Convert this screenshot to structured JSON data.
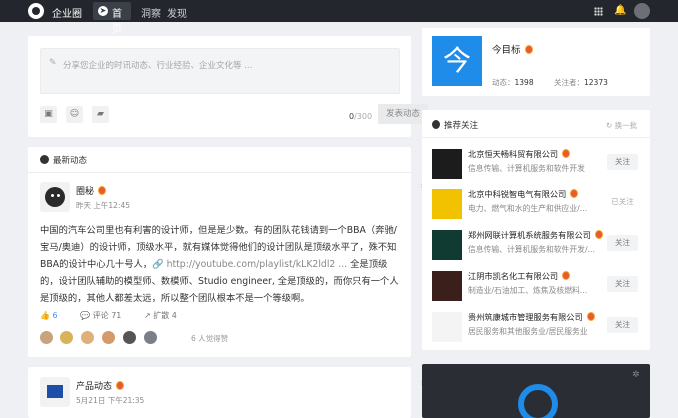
{
  "topbar": {
    "brand": "企业圈",
    "nav": {
      "home": "首页",
      "insight": "洞察",
      "discover": "发现"
    },
    "bell_icon": "🔔"
  },
  "composer": {
    "placeholder": "分享您企业的时讯动态、行业经验、企业文化等 ...",
    "count_current": "0",
    "count_max": "/300",
    "publish_label": "发表动态",
    "tools": [
      "camera-icon",
      "emoji-icon",
      "truck-icon"
    ]
  },
  "feed": {
    "header": "最新动态",
    "post": {
      "user": "圈秘",
      "time": "昨天 上午12:45",
      "body_line1": "中国的汽车公司里也有利害的设计师，但是是少数。有的团队花钱请到一个BBA（奔驰/宝马/奥迪）的设计师，顶级水平，就有媒体觉得他们的设计团队是顶级水平了，殊不知BBA的设计中心几十号人，",
      "link": "http://youtube.com/playlist/kLK2ldl2 ...",
      "body_line2": " 全是顶级的，设计团队辅助的模型师、数模师、Studio engineer, 全是顶级的，而你只有一个人是顶级的，其他人都差太远，所以整个团队根本不是一个等级啊。",
      "likes": "6",
      "comments": "评论 71",
      "shares": "扩散 4",
      "liker_summary": "6 人觉得赞",
      "liker_colors": [
        "#c9a27e",
        "#d9b25a",
        "#e0b07a",
        "#d49a6a",
        "#555",
        "#7a7f88"
      ]
    }
  },
  "product_post": {
    "title": "产品动态",
    "time": "5月21日 下午21:35"
  },
  "profile": {
    "logo_char": "今",
    "name": "今目标",
    "posts_label": "动态：",
    "posts": "1398",
    "followers_label": "关注者：",
    "followers": "12373"
  },
  "recommend": {
    "header": "推荐关注",
    "refresh": "换一批",
    "companies": [
      {
        "name": "北京恒天畅科贸有限公司",
        "desc": "信息传输、计算机服务和软件开发",
        "follow": "关注",
        "followed": false,
        "logo_bg": "#1c1c1c"
      },
      {
        "name": "北京中科锐智电气有限公司",
        "desc": "电力、燃气和水的生产和供应业/...",
        "follow": "已关注",
        "followed": true,
        "logo_bg": "#f2c200"
      },
      {
        "name": "郑州网联计算机系统服务有限公司",
        "desc": "信息传输、计算机服务和软件开发/...",
        "follow": "关注",
        "followed": false,
        "logo_bg": "#0f3b33"
      },
      {
        "name": "江阴市凯名化工有限公司",
        "desc": "制造业/石油加工、炼焦及核燃料...",
        "follow": "关注",
        "followed": false,
        "logo_bg": "#3a1f1a"
      },
      {
        "name": "贵州筑康城市管理服务有限公司",
        "desc": "居民服务和其他服务业/居民服务业",
        "follow": "关注",
        "followed": false,
        "logo_bg": "#f4f4f4"
      }
    ]
  }
}
